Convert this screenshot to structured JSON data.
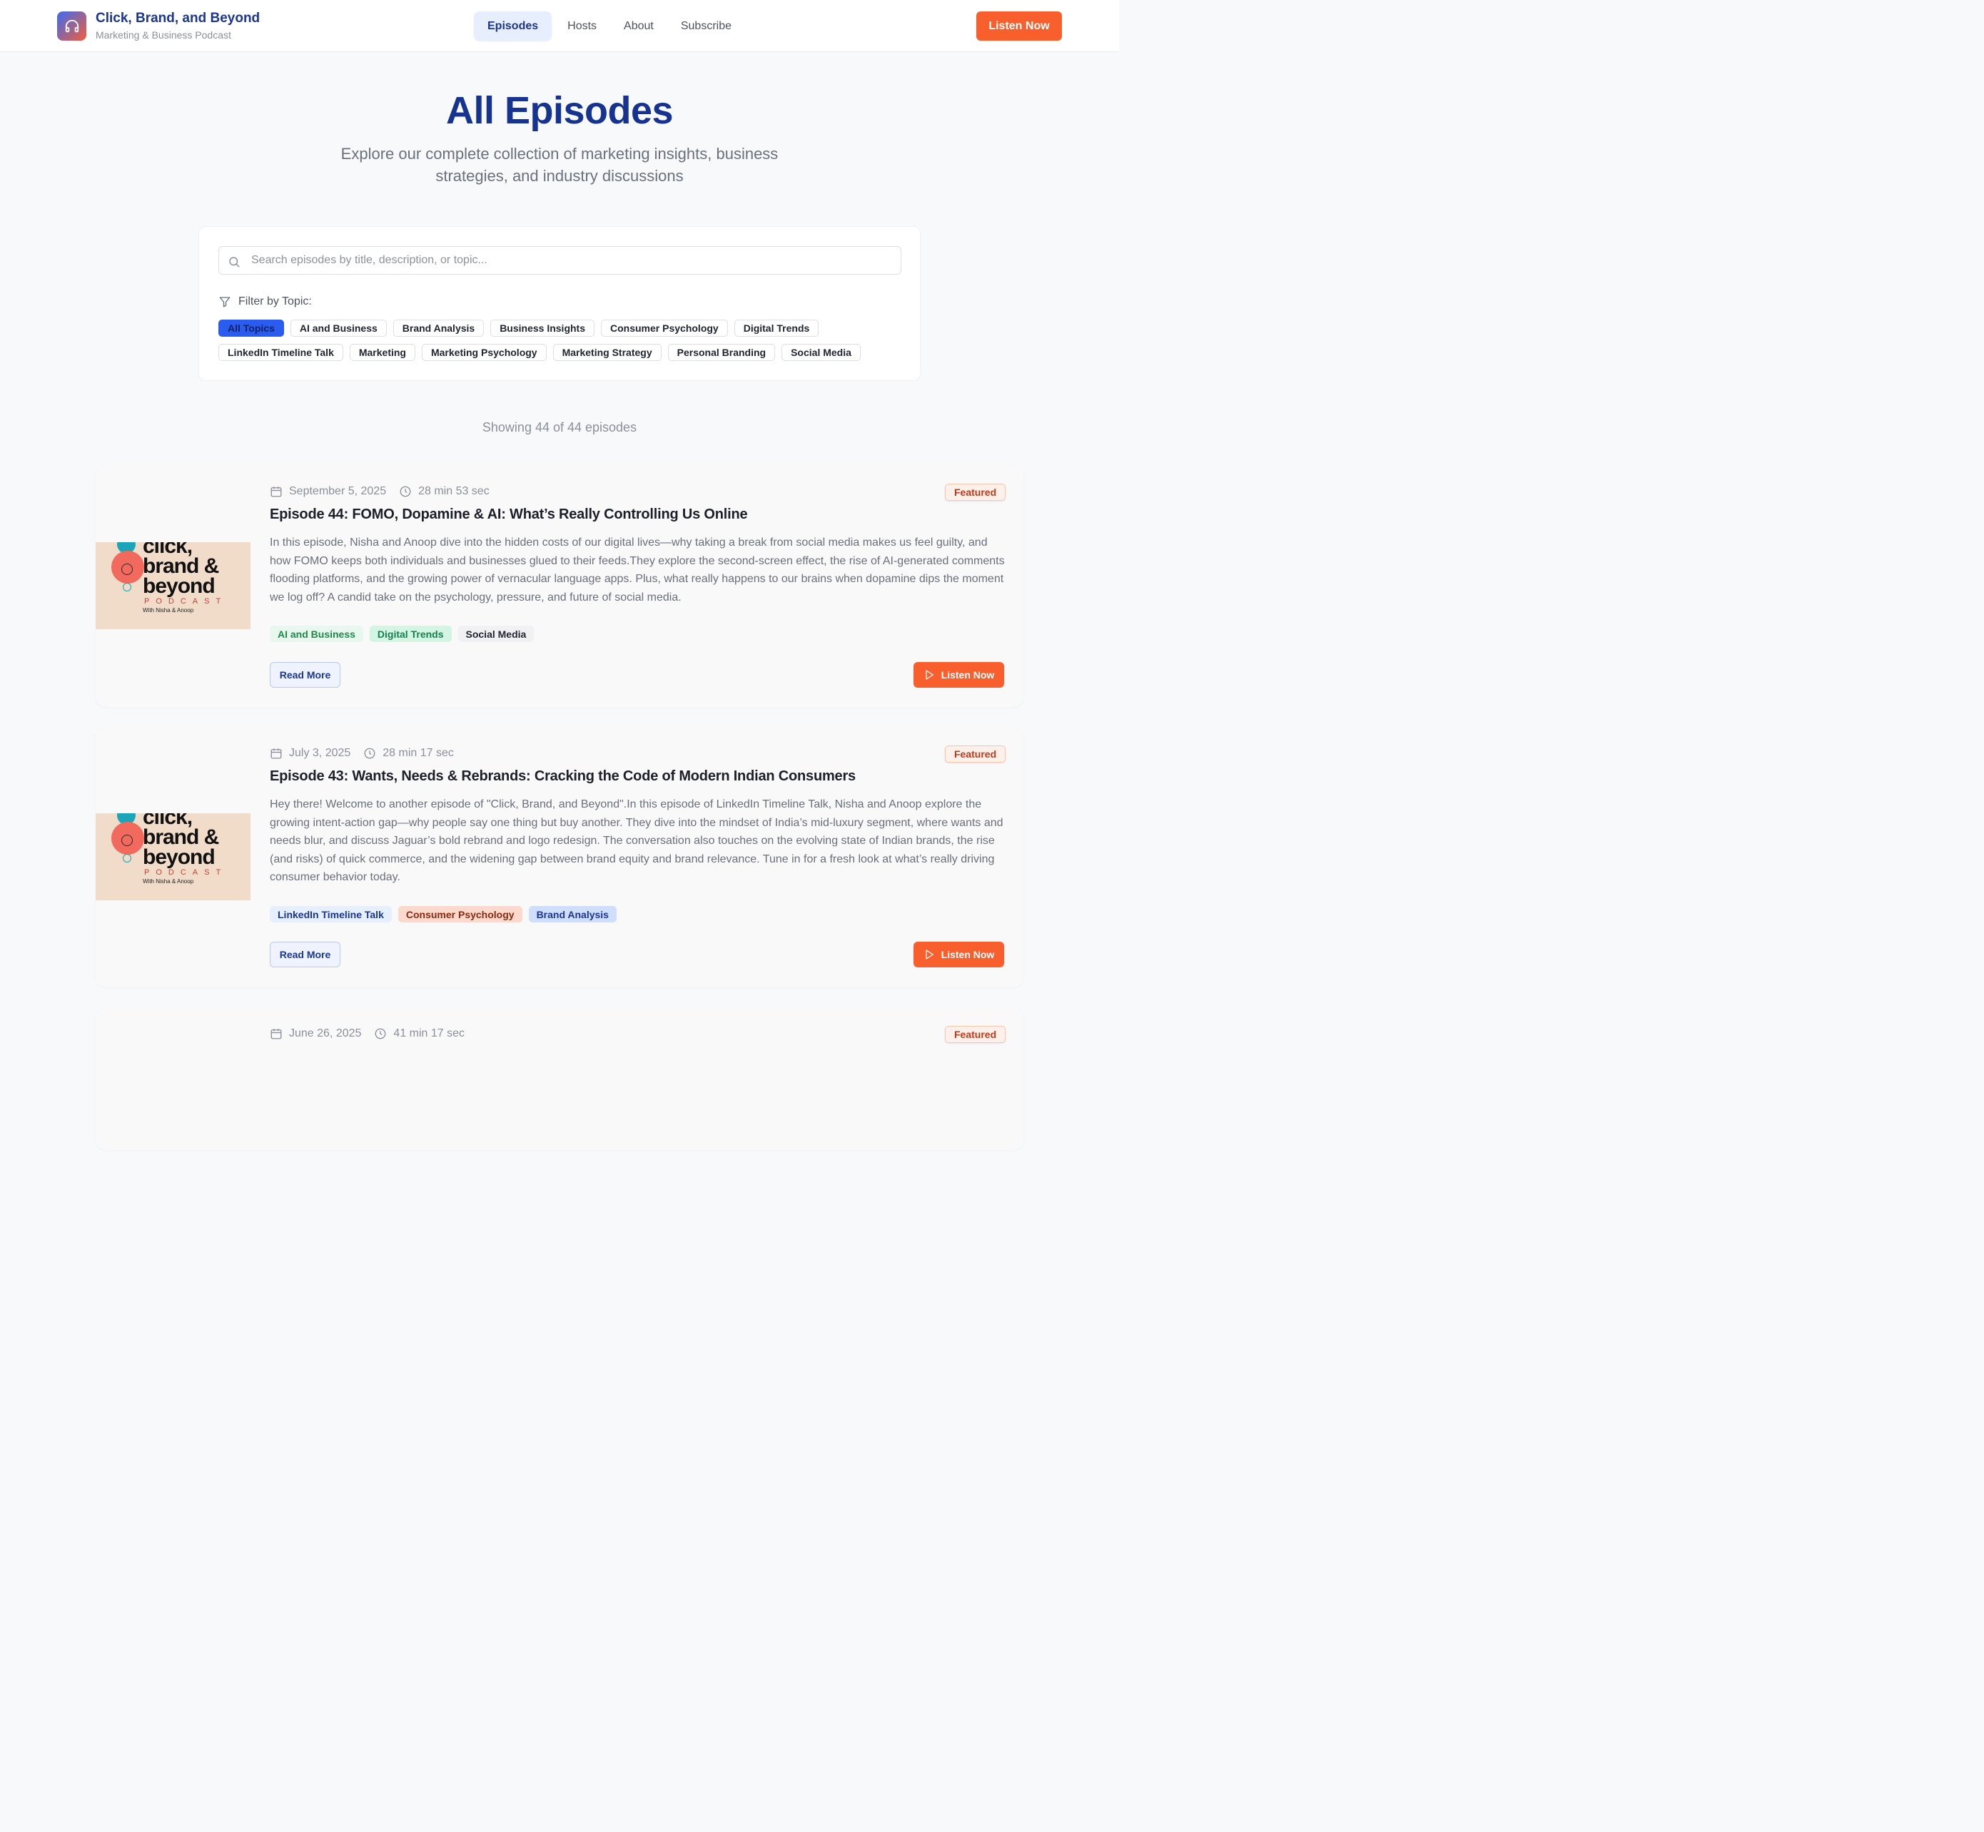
{
  "header": {
    "title": "Click, Brand, and Beyond",
    "subtitle": "Marketing & Business Podcast",
    "nav": [
      "Episodes",
      "Hosts",
      "About",
      "Subscribe"
    ],
    "cta": "Listen Now"
  },
  "hero": {
    "title": "All Episodes",
    "subtitle": "Explore our complete collection of marketing insights, business strategies, and industry discussions"
  },
  "filters": {
    "search_placeholder": "Search episodes by title, description, or topic...",
    "label": "Filter by Topic:",
    "topics": [
      "All Topics",
      "AI and Business",
      "Brand Analysis",
      "Business Insights",
      "Consumer Psychology",
      "Digital Trends",
      "LinkedIn Timeline Talk",
      "Marketing",
      "Marketing Psychology",
      "Marketing Strategy",
      "Personal Branding",
      "Social Media"
    ],
    "active_topic": "All Topics"
  },
  "showing": "Showing 44 of 44 episodes",
  "cover": {
    "title_text": "click, brand & beyond",
    "podcast_word": "PODCAST",
    "hosts_line": "With Nisha & Anoop"
  },
  "episodes": [
    {
      "date": "September 5, 2025",
      "duration": "28 min 53 sec",
      "badge": "Featured",
      "title": "Episode 44: FOMO, Dopamine & AI: What’s Really Controlling Us Online",
      "description": "In this episode, Nisha and Anoop dive into the hidden costs of our digital lives—why taking a break from social media makes us feel guilty, and how FOMO keeps both individuals and businesses glued to their feeds.They explore the second-screen effect, the rise of AI-generated comments flooding platforms, and the growing power of vernacular language apps. Plus, what really happens to our brains when dopamine dips the moment we log off? A candid take on the psychology, pressure, and future of social media.",
      "tags": [
        {
          "label": "AI and Business",
          "bg": "#e8f8ef",
          "fg": "#1e8a4a"
        },
        {
          "label": "Digital Trends",
          "bg": "#d3f5e4",
          "fg": "#16804d"
        },
        {
          "label": "Social Media",
          "bg": "#f1f1f3",
          "fg": "#1f2430"
        }
      ],
      "read_more": "Read More",
      "listen": "Listen Now"
    },
    {
      "date": "July 3, 2025",
      "duration": "28 min 17 sec",
      "badge": "Featured",
      "title": "Episode 43: Wants, Needs & Rebrands: Cracking the Code of Modern Indian Consumers",
      "description": "Hey there! Welcome to another episode of \"Click, Brand, and Beyond\".In this episode of LinkedIn Timeline Talk, Nisha and Anoop explore the growing intent-action gap—why people say one thing but buy another. They dive into the mindset of India’s mid-luxury segment, where wants and needs blur, and discuss Jaguar’s bold rebrand and logo redesign. The conversation also touches on the evolving state of Indian brands, the rise (and risks) of quick commerce, and the widening gap between brand equity and brand relevance. Tune in for a fresh look at what’s really driving consumer behavior today.",
      "tags": [
        {
          "label": "LinkedIn Timeline Talk",
          "bg": "#e6effd",
          "fg": "#1a3596"
        },
        {
          "label": "Consumer Psychology",
          "bg": "#fbd9cc",
          "fg": "#8a2a10"
        },
        {
          "label": "Brand Analysis",
          "bg": "#cfdffb",
          "fg": "#1a3596"
        }
      ],
      "read_more": "Read More",
      "listen": "Listen Now"
    },
    {
      "date": "June 26, 2025",
      "duration": "41 min 17 sec",
      "badge": "Featured"
    }
  ]
}
